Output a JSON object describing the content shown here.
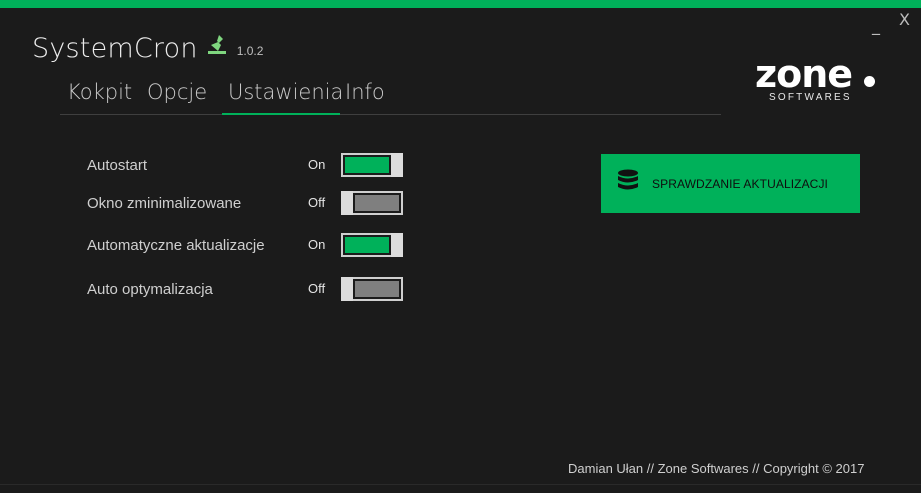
{
  "window": {
    "minimize_label": "_",
    "close_label": "X",
    "accent_color": "#00b15a",
    "background_color": "#1b1b1b"
  },
  "app": {
    "title": "SystemCron",
    "version": "1.0.2",
    "icon": "broom-icon"
  },
  "tabs": [
    {
      "label": "Kokpit",
      "active": false
    },
    {
      "label": "Opcje",
      "active": false
    },
    {
      "label": "Ustawienia",
      "active": true
    },
    {
      "label": "Info",
      "active": false
    }
  ],
  "logo": {
    "main": "zone",
    "sub": "SOFTWARES"
  },
  "settings": [
    {
      "label": "Autostart",
      "state": "On",
      "enabled": true
    },
    {
      "label": "Okno zminimalizowane",
      "state": "Off",
      "enabled": false
    },
    {
      "label": "Automatyczne aktualizacje",
      "state": "On",
      "enabled": true
    },
    {
      "label": "Auto optymalizacja",
      "state": "Off",
      "enabled": false
    }
  ],
  "update_button": {
    "label": "SPRAWDZANIE AKTUALIZACJI",
    "icon": "database-icon"
  },
  "footer": {
    "text": "Damian Ułan // Zone Softwares // Copyright © 2017"
  }
}
